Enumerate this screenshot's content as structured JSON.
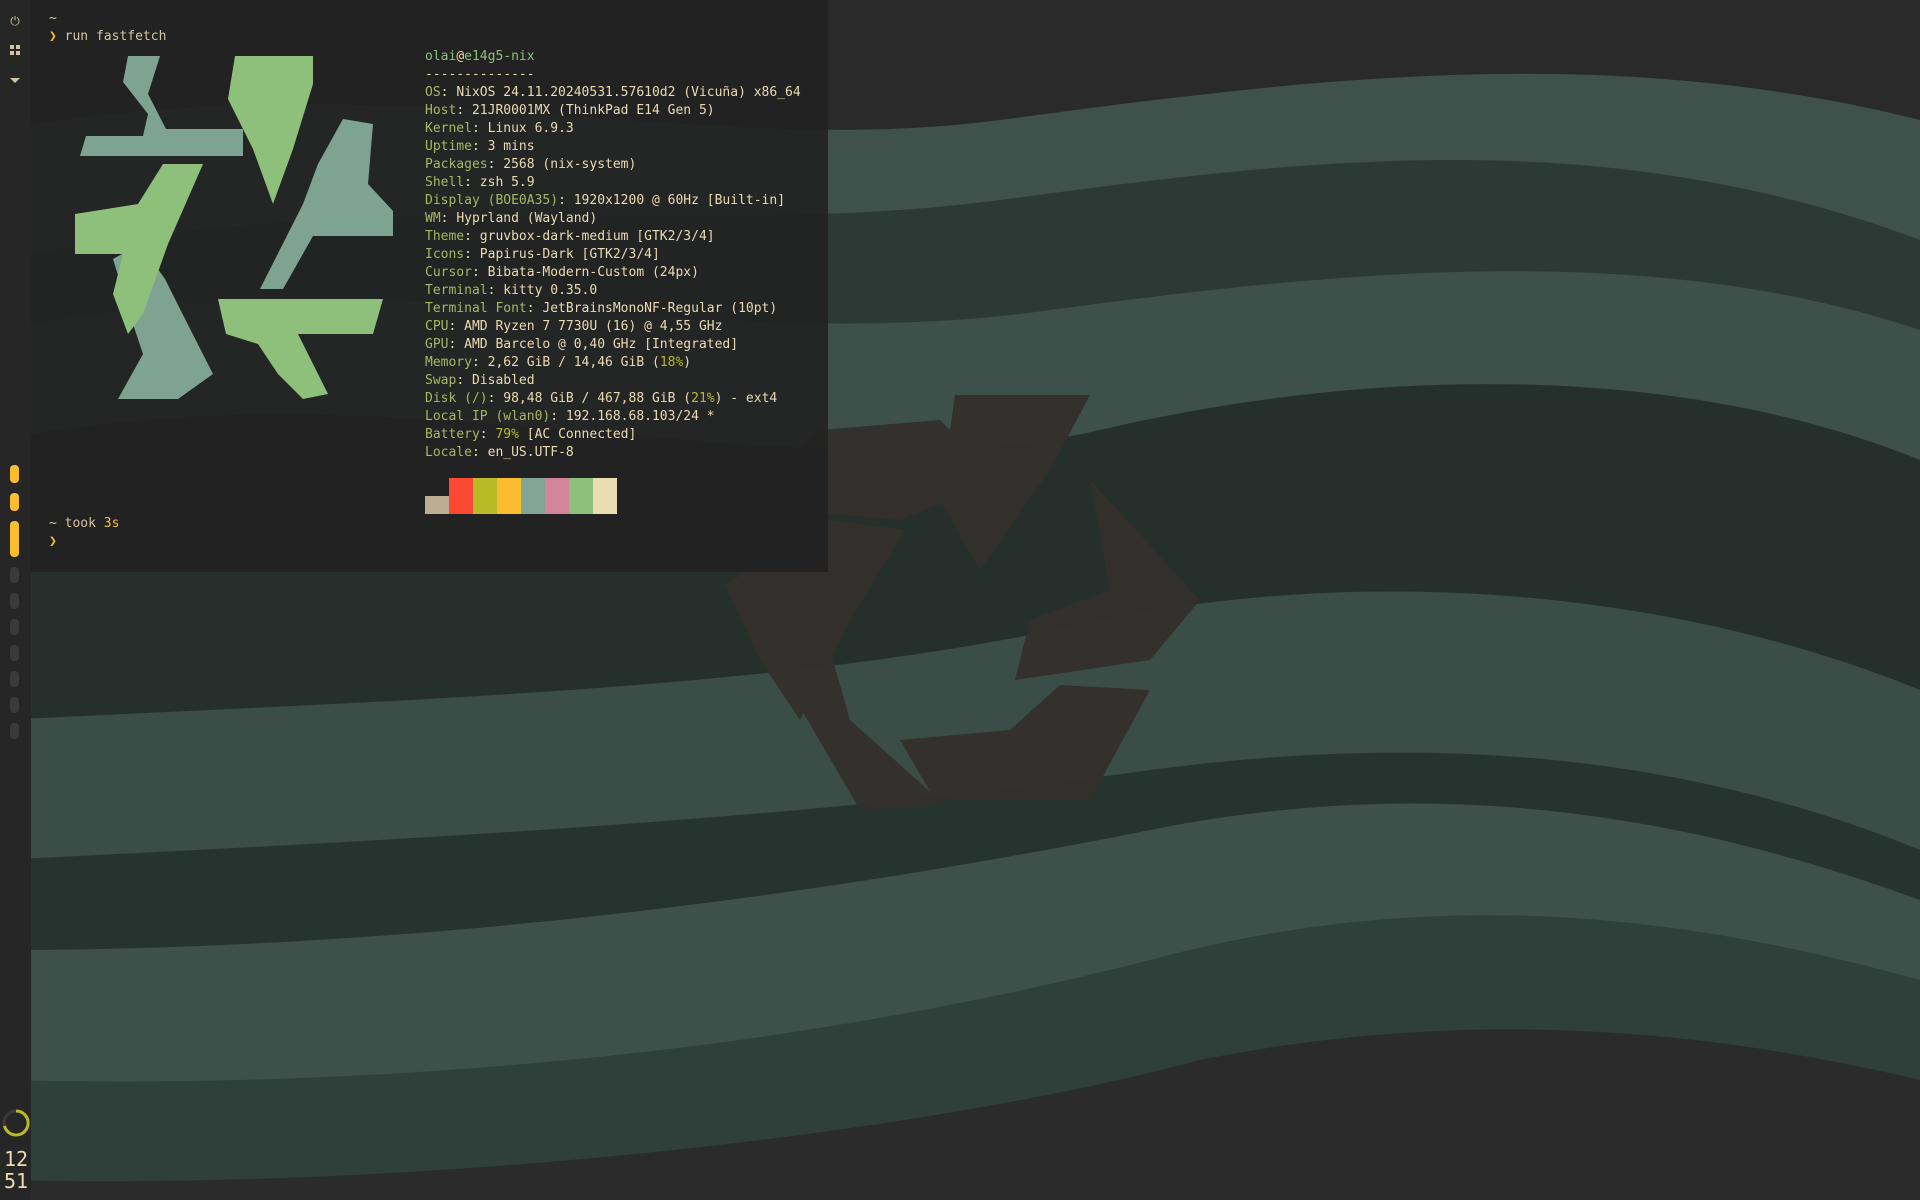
{
  "bar": {
    "icons": [
      "power-icon",
      "grid-icon",
      "chevron-down-icon"
    ],
    "workspaces": [
      {
        "active": true,
        "color": "#fabd2f"
      },
      {
        "active": true,
        "color": "#fabd2f"
      },
      {
        "active": true,
        "current": true,
        "color": "#fabd2f"
      },
      {
        "active": false,
        "color": "#3a3a3a"
      },
      {
        "active": false,
        "color": "#3a3a3a"
      },
      {
        "active": false,
        "color": "#3a3a3a"
      },
      {
        "active": false,
        "color": "#3a3a3a"
      },
      {
        "active": false,
        "color": "#3a3a3a"
      },
      {
        "active": false,
        "color": "#3a3a3a"
      },
      {
        "active": false,
        "color": "#3a3a3a"
      }
    ],
    "clock_hour": "12",
    "clock_minute": "51"
  },
  "terminal": {
    "cwd": "~",
    "prompt_symbol": "❯",
    "command": "run fastfetch",
    "user": "olai",
    "at": "@",
    "host": "e14g5-nix",
    "separator": "--------------",
    "info": [
      {
        "key": "OS",
        "value": "NixOS 24.11.20240531.57610d2 (Vicuña) x86_64"
      },
      {
        "key": "Host",
        "value": "21JR0001MX (ThinkPad E14 Gen 5)"
      },
      {
        "key": "Kernel",
        "value": "Linux 6.9.3"
      },
      {
        "key": "Uptime",
        "value": "3 mins"
      },
      {
        "key": "Packages",
        "value": "2568 (nix-system)"
      },
      {
        "key": "Shell",
        "value": "zsh 5.9"
      },
      {
        "key": "Display (BOE0A35)",
        "value": "1920x1200 @ 60Hz [Built-in]"
      },
      {
        "key": "WM",
        "value": "Hyprland (Wayland)"
      },
      {
        "key": "Theme",
        "value": "gruvbox-dark-medium [GTK2/3/4]"
      },
      {
        "key": "Icons",
        "value": "Papirus-Dark [GTK2/3/4]"
      },
      {
        "key": "Cursor",
        "value": "Bibata-Modern-Custom (24px)"
      },
      {
        "key": "Terminal",
        "value": "kitty 0.35.0"
      },
      {
        "key": "Terminal Font",
        "value": "JetBrainsMonoNF-Regular (10pt)"
      },
      {
        "key": "CPU",
        "value": "AMD Ryzen 7 7730U (16) @ 4,55 GHz"
      },
      {
        "key": "GPU",
        "value": "AMD Barcelo @ 0,40 GHz [Integrated]"
      },
      {
        "key": "Memory",
        "value": "2,62 GiB / 14,46 GiB (",
        "pct": "18%",
        "tail": ")"
      },
      {
        "key": "Swap",
        "value": "Disabled"
      },
      {
        "key": "Disk (/)",
        "value": "98,48 GiB / 467,88 GiB (",
        "pct": "21%",
        "tail": ") - ext4"
      },
      {
        "key": "Local IP (wlan0)",
        "value": "192.168.68.103/24 *"
      },
      {
        "key": "Battery",
        "value": "",
        "pct": "79%",
        "tail": " [AC Connected]"
      },
      {
        "key": "Locale",
        "value": "en_US.UTF-8"
      }
    ],
    "palette": [
      "#bdae93",
      "#fb4934",
      "#b8bb26",
      "#fabd2f",
      "#83a598",
      "#d3869b",
      "#8ec07c",
      "#ebdbb2"
    ],
    "took_prefix": "~ took ",
    "took_time": "3s",
    "logo_colors": {
      "teal": "#7fa393",
      "green": "#8ec07c"
    }
  }
}
